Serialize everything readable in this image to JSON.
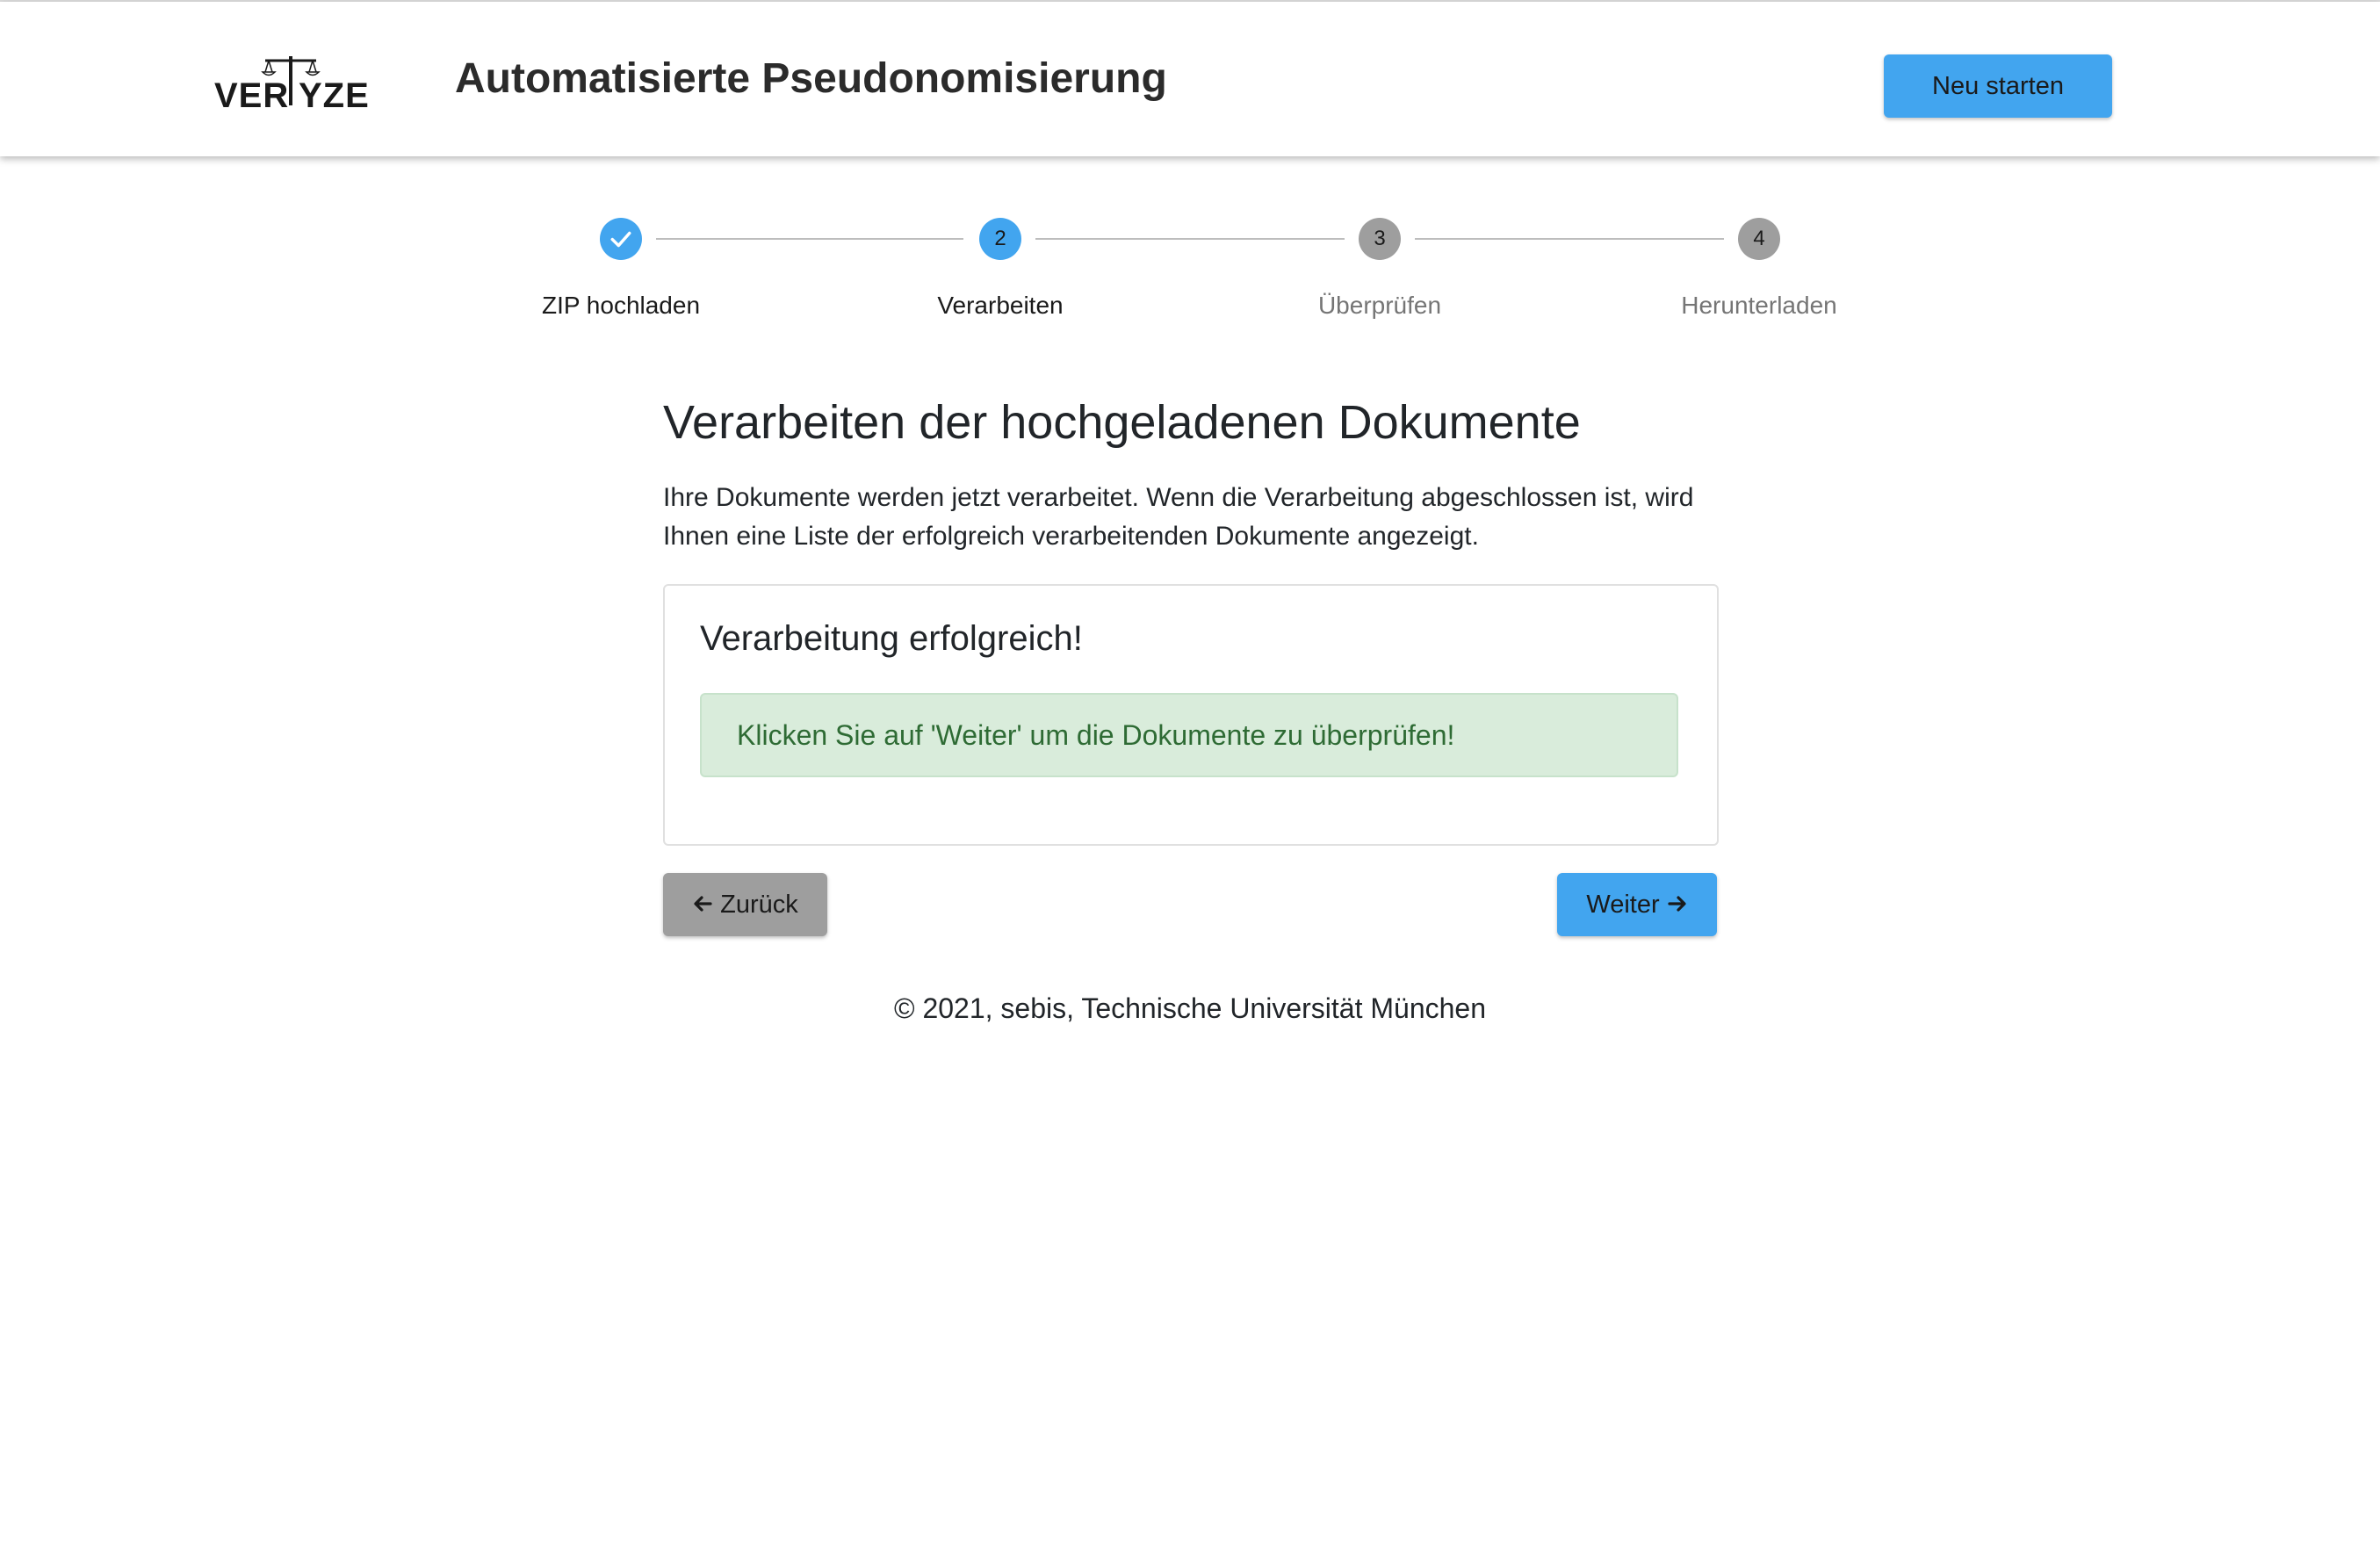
{
  "header": {
    "logo_text": "VERLYZE",
    "title": "Automatisierte Pseudonomisierung",
    "restart_label": "Neu starten"
  },
  "stepper": {
    "steps": [
      {
        "index": "1",
        "label": "ZIP hochladen",
        "state": "completed"
      },
      {
        "index": "2",
        "label": "Verarbeiten",
        "state": "active"
      },
      {
        "index": "3",
        "label": "Überprüfen",
        "state": "pending"
      },
      {
        "index": "4",
        "label": "Herunterladen",
        "state": "pending"
      }
    ]
  },
  "main": {
    "heading": "Verarbeiten der hochgeladenen Dokumente",
    "intro": "Ihre Dokumente werden jetzt verarbeitet. Wenn die Verarbeitung abgeschlossen ist, wird Ihnen eine Liste der erfolgreich verarbeitenden Dokumente angezeigt.",
    "status_card": {
      "title": "Verarbeitung erfolgreich!",
      "message": "Klicken Sie auf 'Weiter' um die Dokumente zu überprüfen!"
    },
    "back_label": "Zurück",
    "next_label": "Weiter"
  },
  "footer": {
    "text": "© 2021, sebis, Technische Universität München"
  },
  "colors": {
    "primary": "#42a5ef",
    "secondary": "#9e9e9e",
    "success_bg": "#d9ecdb",
    "success_text": "#2e6b34"
  }
}
